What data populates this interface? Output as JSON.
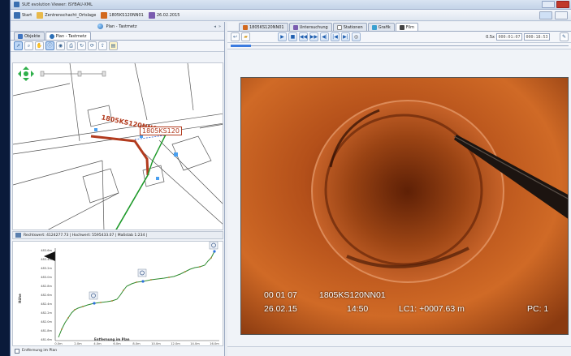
{
  "window": {
    "title": "SUE evolution Viewer: ISYBAU-XML"
  },
  "breadcrumb": [
    {
      "label": "Start",
      "icon": "home-icon",
      "color": "#3a6fb0"
    },
    {
      "label": "Zentrenschacht_Ortslage",
      "icon": "folder-icon",
      "color": "#e8b94a"
    },
    {
      "label": "1805KS120NN01",
      "icon": "pipe-icon",
      "color": "#d2691e"
    },
    {
      "label": "26.02.2015",
      "icon": "calendar-icon",
      "color": "#7a5cb0"
    }
  ],
  "left_panel": {
    "header": "Plan - Tastmetz",
    "tabs": [
      {
        "label": "Objekte",
        "active": false
      },
      {
        "label": "Plan - Tastmetz",
        "active": true
      }
    ],
    "map": {
      "label_upstream": "1805KS120NN01",
      "label_manhole": "1805KS120"
    },
    "status": "Rechtswert: 4124277.73 | Hochwert: 5595433.07 | Maßstab 1:234 |",
    "profile": {
      "ylabel": "Höhe",
      "xlabel": "Entfernung im Plan",
      "y_ticks": [
        "483.6m",
        "483.4m",
        "483.2m",
        "483.0m",
        "482.8m",
        "482.6m",
        "482.4m",
        "482.2m",
        "482.0m",
        "481.8m",
        "481.6m"
      ],
      "x_ticks": [
        "0.0m",
        "2.0m",
        "4.0m",
        "6.0m",
        "8.0m",
        "10.0m",
        "12.0m",
        "14.0m",
        "16.0m"
      ]
    },
    "footer_checkbox": "Entfernung im Plan"
  },
  "right_panel": {
    "tabs": [
      {
        "label": "1805KS120NN01",
        "active": false
      },
      {
        "label": "Untersuchung",
        "active": false
      },
      {
        "label": "Stationen",
        "active": false
      },
      {
        "label": "Grafik",
        "active": false
      },
      {
        "label": "Film",
        "active": true
      }
    ],
    "player": {
      "speed": "0.5x",
      "time_current": "000:01:07",
      "time_total": "000:18:53",
      "progress": 0.06
    },
    "video_osd": {
      "line1_time": "00 01 07",
      "line1_pipe": "1805KS120NN01",
      "line2_date": "26.02.15",
      "line2_clock": "14:50",
      "line2_lc": "LC1: +0007.63 m",
      "line2_pc": "PC: 1"
    }
  },
  "colors": {
    "pipe_red": "#b23b1e",
    "pipe_green": "#1e9a2a",
    "profile_green": "#2d8a2d",
    "video_orange": "#c2571b"
  }
}
